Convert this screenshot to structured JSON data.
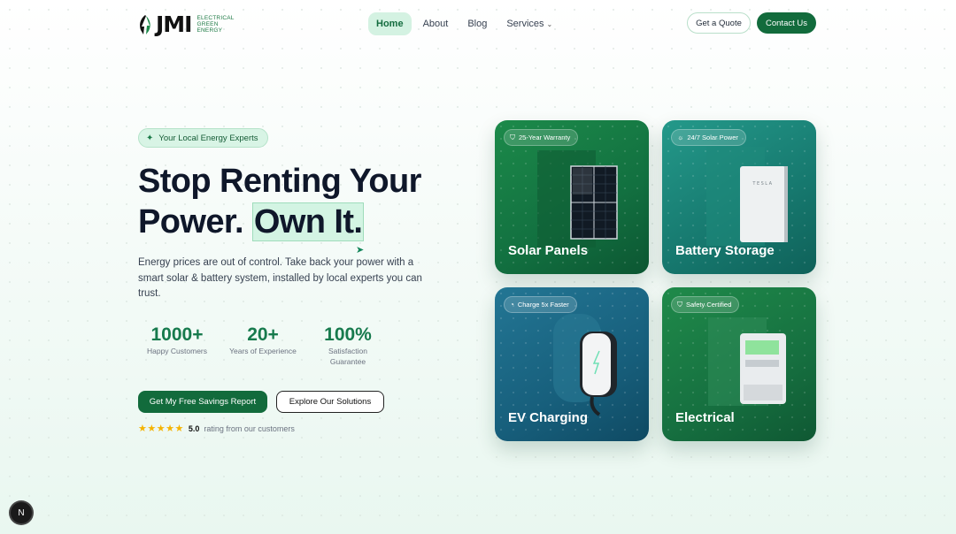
{
  "brand": {
    "mark": "JMI",
    "sub1": "ELECTRICAL",
    "sub2": "GREEN",
    "sub3": "ENERGY"
  },
  "nav": {
    "home": "Home",
    "about": "About",
    "blog": "Blog",
    "services": "Services"
  },
  "header": {
    "quote": "Get a Quote",
    "contact": "Contact Us"
  },
  "hero": {
    "badge": "Your Local Energy Experts",
    "line1": "Stop Renting Your",
    "line2a": "Power.",
    "line2b": "Own It.",
    "description": "Energy prices are out of control. Take back your power with a smart solar & battery system, installed by local experts you can trust.",
    "stats": [
      {
        "value": "1000+",
        "label": "Happy Customers"
      },
      {
        "value": "20+",
        "label": "Years of Experience"
      },
      {
        "value": "100%",
        "label": "Satisfaction Guarantee"
      }
    ],
    "cta_primary": "Get My Free Savings Report",
    "cta_secondary": "Explore Our Solutions",
    "rating_value": "5.0",
    "rating_text": "rating from our customers",
    "stars": "★★★★★"
  },
  "cards": [
    {
      "tag": "25-Year Warranty",
      "title": "Solar Panels",
      "tag_icon": "shield-icon"
    },
    {
      "tag": "24/7 Solar Power",
      "title": "Battery Storage",
      "tag_icon": "sun-icon"
    },
    {
      "tag": "Charge 5x Faster",
      "title": "EV Charging",
      "tag_icon": "gauge-icon"
    },
    {
      "tag": "Safety Certified",
      "title": "Electrical",
      "tag_icon": "shield-check-icon"
    }
  ],
  "battery_brand": "TESLA",
  "dev_badge": "N",
  "colors": {
    "primary": "#126b3c",
    "accent": "#177a4d",
    "highlight": "#d3f4e3"
  }
}
